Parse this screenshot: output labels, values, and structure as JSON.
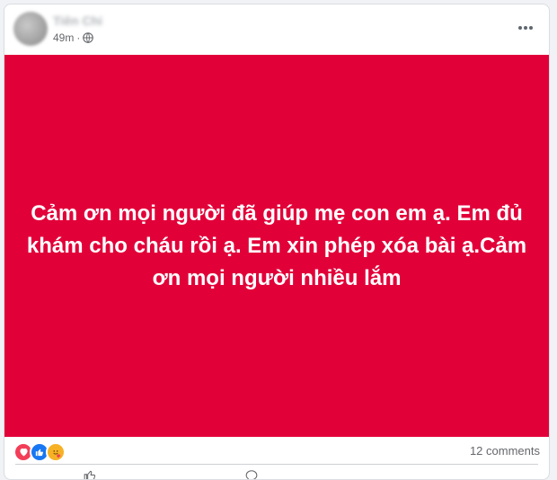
{
  "post": {
    "author_name": "Tiên Chi",
    "timestamp": "49m",
    "audience_icon": "globe-icon",
    "more_icon": "more-dots-icon",
    "status_text": "Cảm ơn mọi người đã giúp mẹ con em ạ. Em đủ khám cho cháu rồi ạ. Em xin phép xóa bài ạ.Cảm ơn mọi người nhiều lắm",
    "background_color": "#e20039",
    "text_color": "#ffffff"
  },
  "reactions": {
    "icons": [
      "love-reaction-icon",
      "like-reaction-icon",
      "care-reaction-icon"
    ],
    "comments_label": "12 comments"
  },
  "actions": {
    "like_icon": "like-icon",
    "comment_icon": "comment-icon"
  }
}
